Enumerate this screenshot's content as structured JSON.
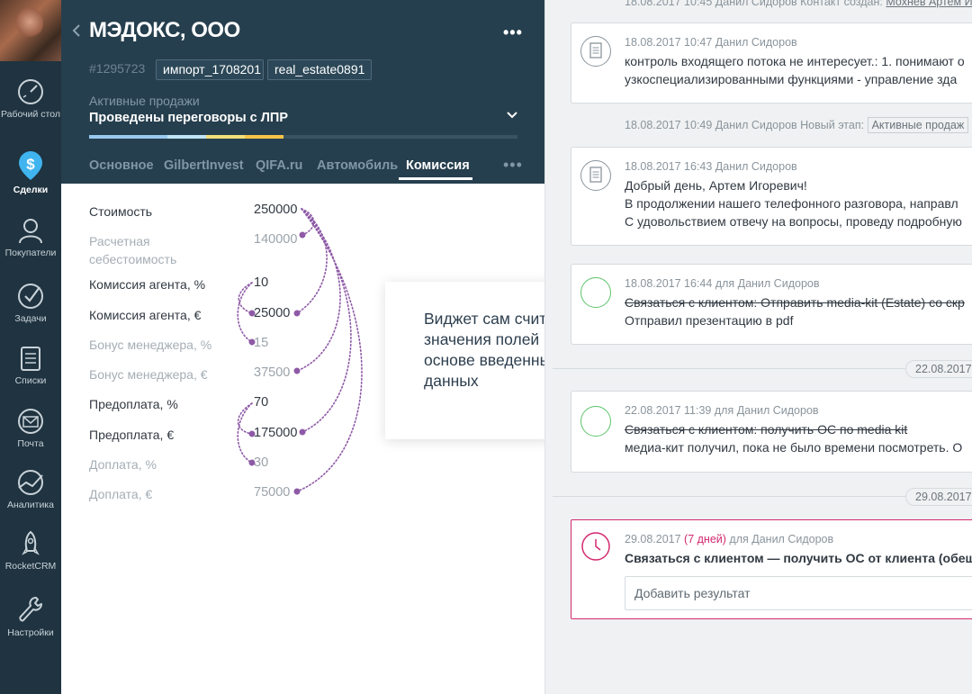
{
  "nav": {
    "items": [
      {
        "label": "Рабочий стол",
        "icon": "dashboard-gauge-icon"
      },
      {
        "label": "Сделки",
        "icon": "deals-dollar-icon",
        "active": true
      },
      {
        "label": "Покупатели",
        "icon": "customers-icon"
      },
      {
        "label": "Задачи",
        "icon": "tasks-check-icon"
      },
      {
        "label": "Списки",
        "icon": "lists-icon"
      },
      {
        "label": "Почта",
        "icon": "mail-icon"
      },
      {
        "label": "Аналитика",
        "icon": "analytics-icon"
      },
      {
        "label": "RocketCRM",
        "icon": "rocket-icon"
      },
      {
        "label": "Настройки",
        "icon": "settings-wrench-icon"
      }
    ]
  },
  "card": {
    "company": "МЭДОКС, ООО",
    "deal_id": "#1295723",
    "tags": [
      "импорт_1708201",
      "real_estate0891"
    ],
    "pipeline": "Активные продажи",
    "stage": "Проведены переговоры с ЛПР",
    "progress_colors": [
      "#99c9f0",
      "#bfe4f5",
      "#f2de7a",
      "#f7c448"
    ],
    "tabs": [
      "Основное",
      "GilbertInvest",
      "QIFA.ru",
      "Автомобиль",
      "Комиссия"
    ],
    "active_tab": "Комиссия"
  },
  "fields": [
    {
      "label": "Стоимость",
      "value": "250000",
      "muted": false
    },
    {
      "label": "Расчетная себестоимость",
      "value": "140000",
      "muted": true
    },
    {
      "label": "Комиссия агента, %",
      "value": "10",
      "muted": false
    },
    {
      "label": "Комиссия агента, €",
      "value": "25000",
      "muted": false
    },
    {
      "label": "Бонус менеджера, %",
      "value": "15",
      "muted": true
    },
    {
      "label": "Бонус менеджера, €",
      "value": "37500",
      "muted": true
    },
    {
      "label": "Предоплата, %",
      "value": "70",
      "muted": false
    },
    {
      "label": "Предоплата, €",
      "value": "175000",
      "muted": false
    },
    {
      "label": "Доплата, %",
      "value": "30",
      "muted": true
    },
    {
      "label": "Доплата, €",
      "value": "75000",
      "muted": true
    }
  ],
  "callout": "Виджет сам считает значения полей на основе введенных данных",
  "feed": {
    "top_line": "18.08.2017 10:45 Данил Сидоров Контакт создан:",
    "top_link": "Мохнев Артем И",
    "notes": [
      {
        "meta": "18.08.2017 10:47 Данил Сидоров",
        "lines": [
          "контроль входящего потока не интересует.: 1. понимают о",
          "узкоспециализированными функциями - управление зда"
        ]
      },
      {
        "meta": "18.08.2017 16:43 Данил Сидоров",
        "lines": [
          "Добрый день, Артем Игоревич!",
          "В продолжении нашего телефонного разговора, направл",
          "С удовольствием отвечу на вопросы, проведу подробную"
        ]
      }
    ],
    "stage_change": {
      "text": "18.08.2017 10:49 Данил Сидоров Новый этап:",
      "stage": "Активные продаж"
    },
    "tasks_done": [
      {
        "meta": "18.08.2017 16:44 для Данил Сидоров",
        "title": "Связаться с клиентом: Отправить media-kit (Estate) со скр",
        "result": "Отправил презентацию в pdf"
      },
      {
        "meta": "22.08.2017 11:39 для Данил Сидоров",
        "title": "Связаться с клиентом: получить ОС по media kit",
        "result": "медиа-кит получил, пока не было времени посмотреть. О"
      }
    ],
    "dates": [
      "22.08.2017",
      "29.08.2017"
    ],
    "open_task": {
      "date": "29.08.2017",
      "overdue": "(7 дней)",
      "assignee": "для Данил Сидоров",
      "title": "Связаться с клиентом — получить ОС от клиента (обещал",
      "result_placeholder": "Добавить результат"
    }
  }
}
